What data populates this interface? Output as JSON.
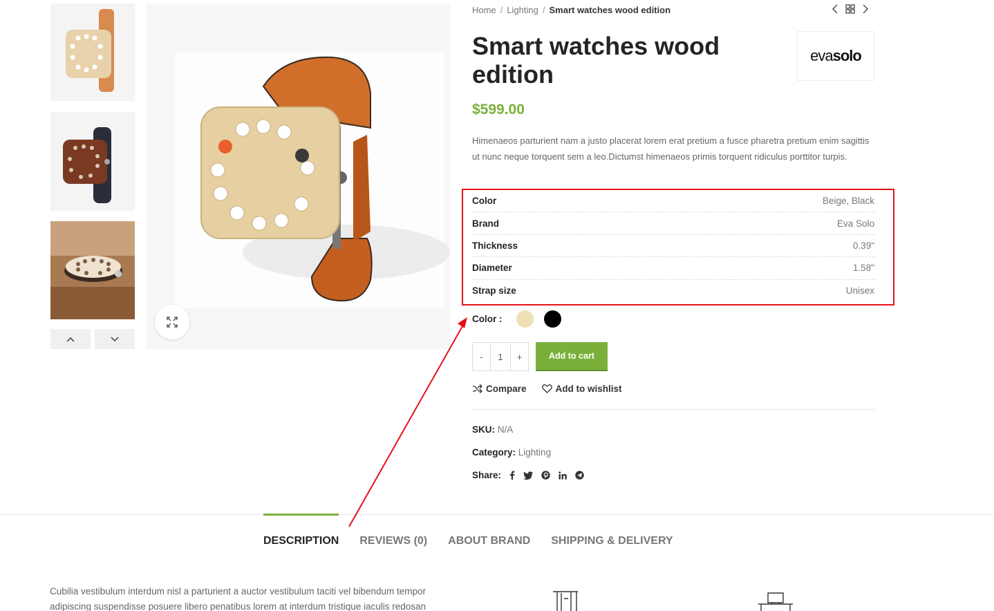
{
  "breadcrumb": {
    "home": "Home",
    "category": "Lighting",
    "current": "Smart watches wood edition",
    "separator": "/"
  },
  "product": {
    "title": "Smart watches wood edition",
    "price": "$599.00",
    "brand_logo_light": "eva",
    "brand_logo_bold": "solo",
    "description": "Himenaeos parturient nam a justo placerat lorem erat pretium a fusce pharetra pretium enim sagittis ut nunc neque torquent sem a leo.Dictumst himenaeos primis torquent ridiculus porttitor turpis."
  },
  "attributes": [
    {
      "name": "Color",
      "value": "Beige, Black"
    },
    {
      "name": "Brand",
      "value": "Eva Solo"
    },
    {
      "name": "Thickness",
      "value": "0.39\""
    },
    {
      "name": "Diameter",
      "value": "1.58\""
    },
    {
      "name": "Strap size",
      "value": "Unisex"
    }
  ],
  "swatches": {
    "label": "Color :",
    "colors": [
      "#ede0b4",
      "#000000"
    ]
  },
  "cart": {
    "qty_minus": "-",
    "qty_value": "1",
    "qty_plus": "+",
    "add_label": "Add to cart"
  },
  "actions": {
    "compare": "Compare",
    "wishlist": "Add to wishlist"
  },
  "meta": {
    "sku_label": "SKU:",
    "sku_value": "N/A",
    "category_label": "Category:",
    "category_value": "Lighting",
    "share_label": "Share:"
  },
  "share_icons": [
    "facebook-icon",
    "twitter-icon",
    "pinterest-icon",
    "linkedin-icon",
    "telegram-icon"
  ],
  "tabs": [
    {
      "label": "Description",
      "active": true
    },
    {
      "label": "Reviews (0)",
      "active": false
    },
    {
      "label": "About brand",
      "active": false
    },
    {
      "label": "Shipping & Delivery",
      "active": false
    }
  ],
  "description_tab_text": "Cubilia vestibulum interdum nisl a parturient a auctor vestibulum taciti vel bibendum tempor adipiscing suspendisse posuere libero penatibus lorem at interdum tristique iaculis redosan",
  "colors": {
    "accent": "#7ab03a",
    "highlight": "#e4101a",
    "title": "#242424"
  }
}
